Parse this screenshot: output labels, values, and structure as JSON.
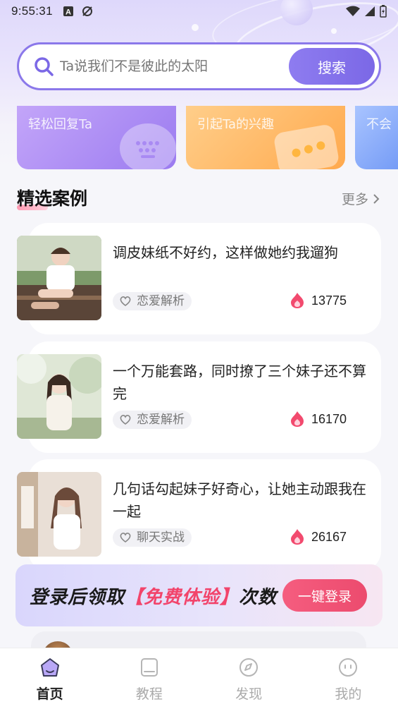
{
  "status_bar": {
    "time": "9:55:31"
  },
  "search": {
    "placeholder": "Ta说我们不是彼此的太阳",
    "button_label": "搜索"
  },
  "feature_cards": [
    {
      "label": "轻松回复Ta"
    },
    {
      "label": "引起Ta的兴趣"
    },
    {
      "label": "不会"
    }
  ],
  "section": {
    "title": "精选案例",
    "more_label": "更多"
  },
  "cases": [
    {
      "title": "调皮妹纸不好约，这样做她约我遛狗",
      "tag": "恋爱解析",
      "count": "13775"
    },
    {
      "title": "一个万能套路，同时撩了三个妹子还不算完",
      "tag": "恋爱解析",
      "count": "16170"
    },
    {
      "title": "几句话勾起妹子好奇心，让她主动跟我在一起",
      "tag": "聊天实战",
      "count": "26167"
    }
  ],
  "login_banner": {
    "text_before": "登录后领取",
    "text_accent": "【免费体验】",
    "text_after": "次数",
    "button_label": "一键登录"
  },
  "tab_bar": [
    {
      "label": "首页",
      "icon": "home-icon",
      "active": true
    },
    {
      "label": "教程",
      "icon": "book-icon",
      "active": false
    },
    {
      "label": "发现",
      "icon": "compass-icon",
      "active": false
    },
    {
      "label": "我的",
      "icon": "face-icon",
      "active": false
    }
  ],
  "colors": {
    "accent": "#8b78ea",
    "hot": "#f24a6e",
    "login": "#ec4b6e"
  }
}
